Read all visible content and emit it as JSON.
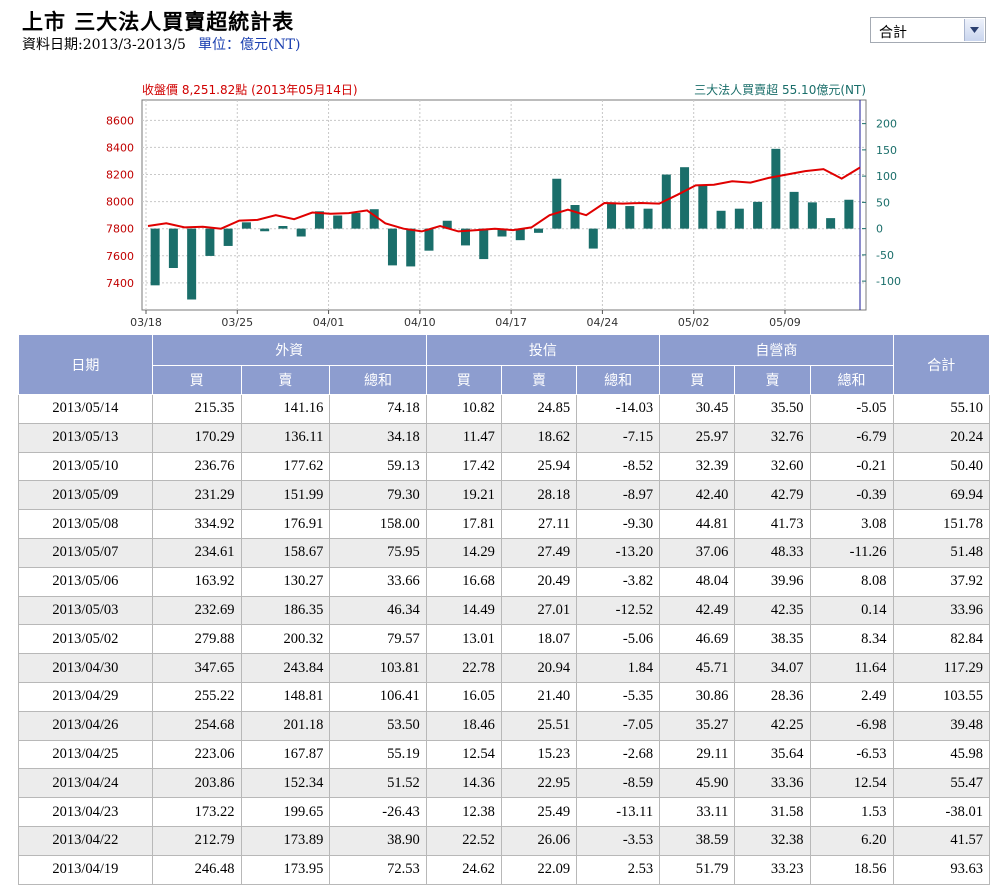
{
  "page": {
    "title": "上市 三大法人買賣超統計表",
    "date_range": "資料日期:2013/3-2013/5",
    "unit": "單位：億元(NT)"
  },
  "selector": {
    "value": "合計"
  },
  "chart_labels": {
    "left_title": "收盤價 8,251.82點 (2013年05月14日)",
    "right_title": "三大法人買賣超 55.10億元(NT)"
  },
  "chart_data": {
    "type": "bar+line",
    "x_tick_labels": [
      "03/18",
      "03/25",
      "04/01",
      "04/10",
      "04/17",
      "04/24",
      "05/02",
      "05/09"
    ],
    "left_axis": {
      "ticks": [
        7400,
        7600,
        7800,
        8000,
        8200,
        8400,
        8600
      ],
      "range": [
        7200,
        8750
      ]
    },
    "right_axis": {
      "ticks": [
        -100,
        -50,
        0,
        50,
        100,
        150,
        200
      ],
      "range": [
        -155,
        245
      ]
    },
    "bars": [
      -108,
      -75,
      -135,
      -52,
      -33,
      12,
      -5,
      5,
      -15,
      33,
      25,
      30,
      37,
      -70,
      -72,
      -42,
      15,
      -32,
      -58,
      -15,
      -22,
      -8,
      95,
      45,
      -38,
      50,
      43,
      38,
      103,
      117,
      83,
      34,
      38,
      51,
      152,
      70,
      50,
      20,
      55
    ],
    "line": [
      7820,
      7840,
      7810,
      7815,
      7800,
      7860,
      7865,
      7900,
      7870,
      7920,
      7910,
      7915,
      7935,
      7840,
      7800,
      7780,
      7820,
      7780,
      7790,
      7800,
      7790,
      7810,
      7900,
      7940,
      7900,
      7990,
      7985,
      7990,
      7985,
      8050,
      8120,
      8125,
      8150,
      8140,
      8175,
      8200,
      8225,
      8240,
      8170,
      8251.82
    ],
    "series": [
      {
        "name": "收盤價",
        "type": "line",
        "color": "#e00000"
      },
      {
        "name": "三大法人買賣超",
        "type": "bar",
        "color": "#1a6e6a"
      }
    ]
  },
  "table": {
    "headers": {
      "date": "日期",
      "groups": [
        "外資",
        "投信",
        "自營商"
      ],
      "sub": [
        "買",
        "賣",
        "總和"
      ],
      "total": "合計"
    },
    "rows": [
      [
        "2013/05/14",
        "215.35",
        "141.16",
        "74.18",
        "10.82",
        "24.85",
        "-14.03",
        "30.45",
        "35.50",
        "-5.05",
        "55.10"
      ],
      [
        "2013/05/13",
        "170.29",
        "136.11",
        "34.18",
        "11.47",
        "18.62",
        "-7.15",
        "25.97",
        "32.76",
        "-6.79",
        "20.24"
      ],
      [
        "2013/05/10",
        "236.76",
        "177.62",
        "59.13",
        "17.42",
        "25.94",
        "-8.52",
        "32.39",
        "32.60",
        "-0.21",
        "50.40"
      ],
      [
        "2013/05/09",
        "231.29",
        "151.99",
        "79.30",
        "19.21",
        "28.18",
        "-8.97",
        "42.40",
        "42.79",
        "-0.39",
        "69.94"
      ],
      [
        "2013/05/08",
        "334.92",
        "176.91",
        "158.00",
        "17.81",
        "27.11",
        "-9.30",
        "44.81",
        "41.73",
        "3.08",
        "151.78"
      ],
      [
        "2013/05/07",
        "234.61",
        "158.67",
        "75.95",
        "14.29",
        "27.49",
        "-13.20",
        "37.06",
        "48.33",
        "-11.26",
        "51.48"
      ],
      [
        "2013/05/06",
        "163.92",
        "130.27",
        "33.66",
        "16.68",
        "20.49",
        "-3.82",
        "48.04",
        "39.96",
        "8.08",
        "37.92"
      ],
      [
        "2013/05/03",
        "232.69",
        "186.35",
        "46.34",
        "14.49",
        "27.01",
        "-12.52",
        "42.49",
        "42.35",
        "0.14",
        "33.96"
      ],
      [
        "2013/05/02",
        "279.88",
        "200.32",
        "79.57",
        "13.01",
        "18.07",
        "-5.06",
        "46.69",
        "38.35",
        "8.34",
        "82.84"
      ],
      [
        "2013/04/30",
        "347.65",
        "243.84",
        "103.81",
        "22.78",
        "20.94",
        "1.84",
        "45.71",
        "34.07",
        "11.64",
        "117.29"
      ],
      [
        "2013/04/29",
        "255.22",
        "148.81",
        "106.41",
        "16.05",
        "21.40",
        "-5.35",
        "30.86",
        "28.36",
        "2.49",
        "103.55"
      ],
      [
        "2013/04/26",
        "254.68",
        "201.18",
        "53.50",
        "18.46",
        "25.51",
        "-7.05",
        "35.27",
        "42.25",
        "-6.98",
        "39.48"
      ],
      [
        "2013/04/25",
        "223.06",
        "167.87",
        "55.19",
        "12.54",
        "15.23",
        "-2.68",
        "29.11",
        "35.64",
        "-6.53",
        "45.98"
      ],
      [
        "2013/04/24",
        "203.86",
        "152.34",
        "51.52",
        "14.36",
        "22.95",
        "-8.59",
        "45.90",
        "33.36",
        "12.54",
        "55.47"
      ],
      [
        "2013/04/23",
        "173.22",
        "199.65",
        "-26.43",
        "12.38",
        "25.49",
        "-13.11",
        "33.11",
        "31.58",
        "1.53",
        "-38.01"
      ],
      [
        "2013/04/22",
        "212.79",
        "173.89",
        "38.90",
        "22.52",
        "26.06",
        "-3.53",
        "38.59",
        "32.38",
        "6.20",
        "41.57"
      ],
      [
        "2013/04/19",
        "246.48",
        "173.95",
        "72.53",
        "24.62",
        "22.09",
        "2.53",
        "51.79",
        "33.23",
        "18.56",
        "93.63"
      ]
    ]
  }
}
